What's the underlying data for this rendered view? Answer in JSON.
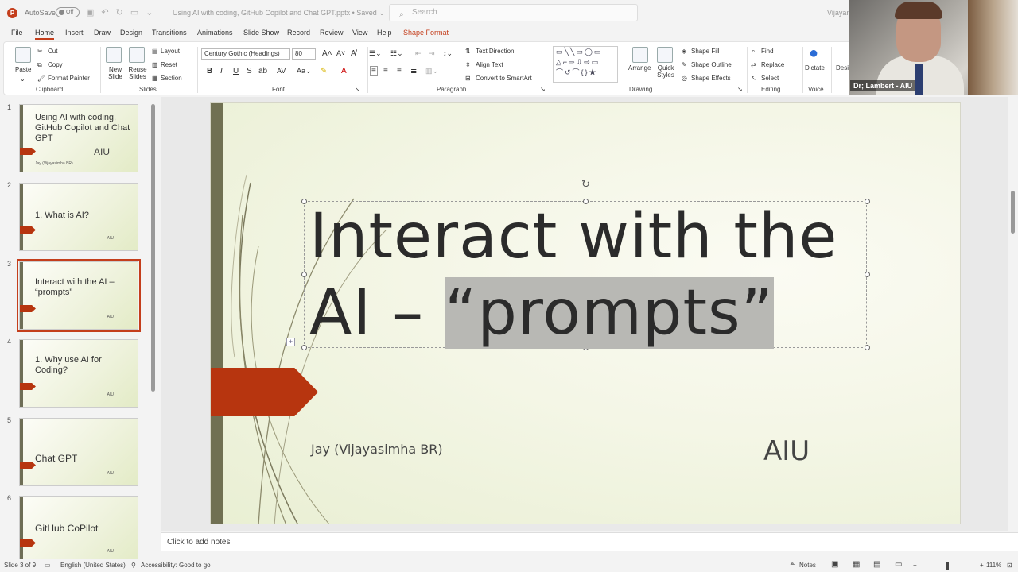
{
  "titlebar": {
    "autosave_label": "AutoSave",
    "autosave_state": "Off",
    "document_title": "Using AI with coding, GitHub Copilot and Chat GPT.pptx  •  Saved  ⌄",
    "search_placeholder": "Search",
    "user_name": "Vijayan"
  },
  "menu": {
    "tabs": [
      "File",
      "Home",
      "Insert",
      "Draw",
      "Design",
      "Transitions",
      "Animations",
      "Slide Show",
      "Record",
      "Review",
      "View",
      "Help",
      "Shape Format"
    ],
    "active": "Home"
  },
  "ribbon": {
    "clipboard": {
      "paste": "Paste",
      "cut": "Cut",
      "copy": "Copy",
      "format_painter": "Format Painter",
      "label": "Clipboard"
    },
    "slides": {
      "new_slide": "New Slide",
      "reuse_slides": "Reuse Slides",
      "layout": "Layout",
      "reset": "Reset",
      "section": "Section",
      "label": "Slides"
    },
    "font": {
      "family": "Century Gothic (Headings)",
      "size": "80",
      "bold": "B",
      "italic": "I",
      "underline": "U",
      "strike": "S",
      "label": "Font"
    },
    "paragraph": {
      "text_direction": "Text Direction",
      "align_text": "Align Text",
      "smartart": "Convert to SmartArt",
      "label": "Paragraph"
    },
    "drawing": {
      "arrange": "Arrange",
      "quick_styles": "Quick Styles",
      "shape_fill": "Shape Fill",
      "shape_outline": "Shape Outline",
      "shape_effects": "Shape Effects",
      "label": "Drawing"
    },
    "editing": {
      "find": "Find",
      "replace": "Replace",
      "select": "Select",
      "label": "Editing"
    },
    "voice": {
      "dictate": "Dictate",
      "label": "Voice"
    },
    "designer": {
      "label": "Desi"
    }
  },
  "video": {
    "name": "Dr; Lambert - AIU"
  },
  "thumbnails": [
    {
      "num": "1",
      "title": "Using AI with coding, GitHub Copilot and Chat GPT",
      "sub": "Jay (Vijayasimha BR)",
      "aiu": "AIU"
    },
    {
      "num": "2",
      "title": "1. What is AI?",
      "sub": "",
      "aiu": "AIU"
    },
    {
      "num": "3",
      "title": "Interact with the AI – “prompts”",
      "sub": "",
      "aiu": "AIU"
    },
    {
      "num": "4",
      "title": "1. Why use AI for Coding?",
      "sub": "",
      "aiu": "AIU"
    },
    {
      "num": "5",
      "title": "Chat GPT",
      "sub": "",
      "aiu": "AIU"
    },
    {
      "num": "6",
      "title": "GitHub CoPilot",
      "sub": "",
      "aiu": "AIU"
    }
  ],
  "slide": {
    "title_line1": "Interact with the",
    "title_line2_prefix": "AI – ",
    "title_line2_highlight": "“prompts”",
    "subtitle": "Jay (Vijayasimha BR)",
    "org": "AIU"
  },
  "notes_placeholder": "Click to add notes",
  "status": {
    "slide_info": "Slide 3 of 9",
    "language": "English (United States)",
    "accessibility": "Accessibility: Good to go",
    "notes": "Notes",
    "zoom": "111%"
  }
}
